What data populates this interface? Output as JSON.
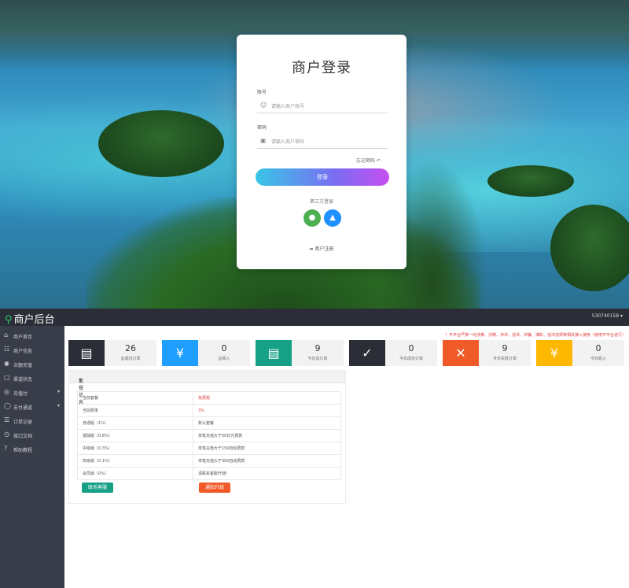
{
  "login": {
    "title": "商户登录",
    "account_label": "账号",
    "account_placeholder": "请输入商户账号",
    "password_label": "密码",
    "password_placeholder": "请输入商户密码",
    "forgot": "忘记密码",
    "login_button": "登录",
    "third_party_label": "第三方登录",
    "register": "商户注册",
    "colors": {
      "button_gradient": [
        "#38c6e6",
        "#c64ff0"
      ],
      "wechat": "#4caf50",
      "qq": "#1e90ff"
    }
  },
  "admin": {
    "brand": "商户后台",
    "account": "530740158",
    "notice": "！平平台严禁一切涉黄、涉赌、涉诈、违法、诈骗、博彩、违法违规等相关接入使用（使用平平台进行）",
    "nav": [
      {
        "label": "商户首页",
        "icon": "home-icon"
      },
      {
        "label": "商户信息",
        "icon": "user-icon"
      },
      {
        "label": "余额充值",
        "icon": "wallet-icon"
      },
      {
        "label": "渠道状态",
        "icon": "monitor-icon"
      },
      {
        "label": "充值付",
        "icon": "pay-icon",
        "expand": "▾"
      },
      {
        "label": "支付通道",
        "icon": "shield-icon",
        "expand": "▾"
      },
      {
        "label": "订单记录",
        "icon": "list-icon"
      },
      {
        "label": "接口文档",
        "icon": "doc-icon"
      },
      {
        "label": "帮助教程",
        "icon": "help-icon"
      }
    ],
    "stats": [
      {
        "value": "26",
        "label": "总成功订单",
        "color": "#2b2e37",
        "icon": "clipboard-icon"
      },
      {
        "value": "0",
        "label": "总收入",
        "color": "#1e9fff",
        "icon": "yen-icon"
      },
      {
        "value": "9",
        "label": "今日总订单",
        "color": "#16a085",
        "icon": "clipboard-icon"
      },
      {
        "value": "0",
        "label": "今日成功订单",
        "color": "#2b2e37",
        "icon": "check-icon"
      },
      {
        "value": "9",
        "label": "今日失败订单",
        "color": "#f05a28",
        "icon": "cross-icon"
      },
      {
        "value": "0",
        "label": "今日收入",
        "color": "#ffb800",
        "icon": "yen-icon"
      }
    ],
    "panel_title": "套餐信息",
    "table": [
      [
        "当前套餐",
        "免费版"
      ],
      [
        "当前费率",
        "3%"
      ],
      [
        "普通版（1%）",
        "默认套餐"
      ],
      [
        "基础版（0.8%）",
        "单笔充值大于50日元费款"
      ],
      [
        "中级版（0.3%）",
        "单笔充值大于150自动费款"
      ],
      [
        "高级版（0.1%）",
        "单笔充值大于300自动费款"
      ],
      [
        "会员版（0%）",
        "请联系客服开通！"
      ]
    ],
    "contact_button": "联系客服",
    "upgrade_button": "通知升级"
  }
}
